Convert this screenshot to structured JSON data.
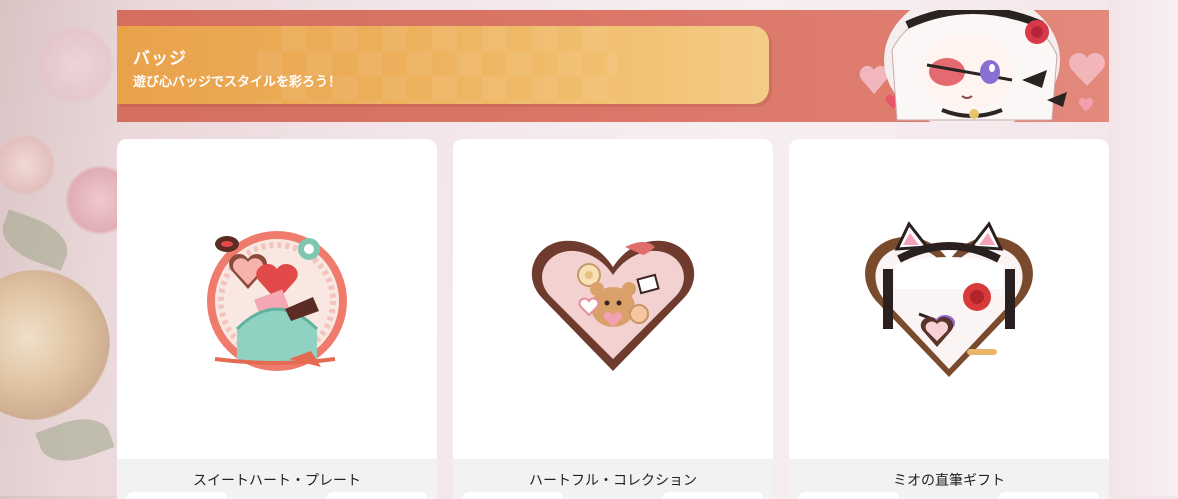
{
  "banner": {
    "title": "バッジ",
    "subtitle": "遊び心バッジでスタイルを彩ろう！"
  },
  "badges": [
    {
      "name": "スイートハート・プレート",
      "icon": "chocolate-plate-icon"
    },
    {
      "name": "ハートフル・コレクション",
      "icon": "heart-box-icon"
    },
    {
      "name": "ミオの直筆ギフト",
      "icon": "mio-gift-icon"
    }
  ],
  "colors": {
    "banner_bg": "#d97565",
    "banner_plate": "#eda955",
    "card_bg": "#ffffff",
    "card_footer": "#f2f2f2"
  }
}
